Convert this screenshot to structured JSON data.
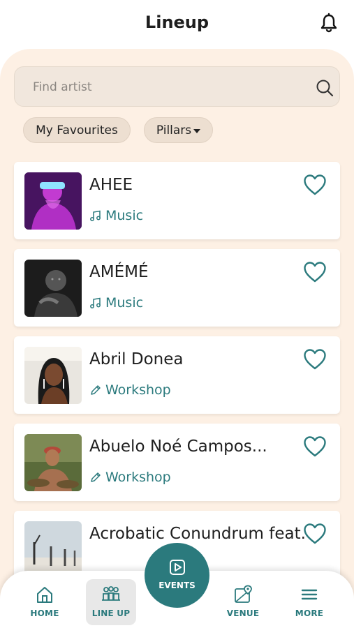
{
  "header": {
    "title": "Lineup",
    "bell_icon": "bell-icon"
  },
  "search": {
    "placeholder": "Find artist",
    "value": "",
    "icon": "search-icon"
  },
  "filters": {
    "favourites_label": "My Favourites",
    "pillars_label": "Pillars"
  },
  "artists": [
    {
      "name": "AHEE",
      "pillar": "Music",
      "pillar_icon": "music-note-icon",
      "favourited": false
    },
    {
      "name": "AMÉMÉ",
      "pillar": "Music",
      "pillar_icon": "music-note-icon",
      "favourited": false
    },
    {
      "name": "Abril Donea",
      "pillar": "Workshop",
      "pillar_icon": "pencil-icon",
      "favourited": false
    },
    {
      "name": "Abuelo Noé Campos...",
      "pillar": "Workshop",
      "pillar_icon": "pencil-icon",
      "favourited": false
    },
    {
      "name": "Acrobatic Conundrum feat.",
      "pillar": "",
      "pillar_icon": "",
      "favourited": false
    }
  ],
  "nav": {
    "home": "HOME",
    "lineup": "LINE UP",
    "events": "EVENTS",
    "venue": "VENUE",
    "more": "MORE",
    "active": "lineup"
  },
  "colors": {
    "accent": "#2b7a7d",
    "background": "#fdf0e4",
    "chip": "#eddfd1",
    "search": "#f1e7dd"
  }
}
